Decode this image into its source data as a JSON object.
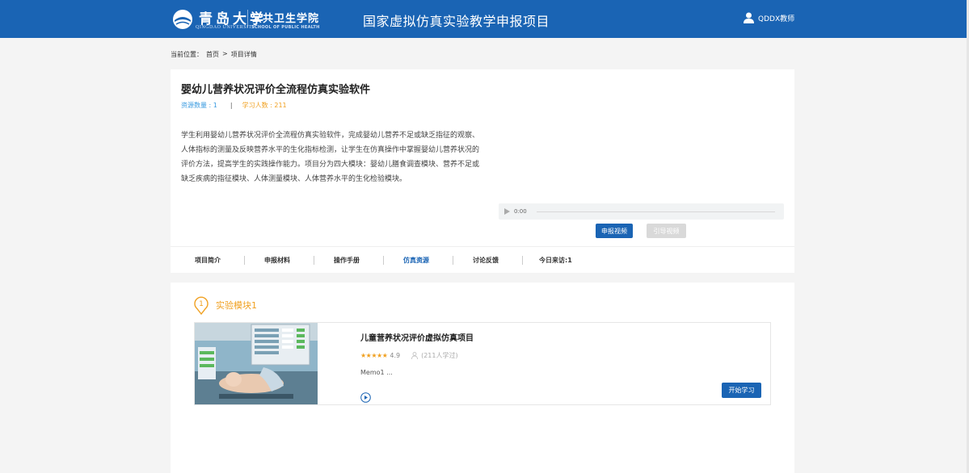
{
  "header": {
    "logo_cn": "青岛大学",
    "logo_en": "QINGDAO UNIVERSITY",
    "school_name": "公共卫生学院",
    "school_en": "SCHOOL OF PUBLIC HEALTH",
    "site_title": "国家虚拟仿真实验教学申报项目",
    "user_name": "QDDX教师",
    "user_icon": "user-icon",
    "brand_color": "#1a64b4"
  },
  "breadcrumb": {
    "label": "当前位置：",
    "home": "首页",
    "separator": ">",
    "current": "项目详情"
  },
  "project": {
    "title": "婴幼儿营养状况评价全流程仿真实验软件",
    "resource_count": "资源数量 : 1",
    "divider": "|",
    "learner_count": "学习人数 : 211",
    "description": "学生利用婴幼儿营养状况评价全流程仿真实验软件，完成婴幼儿营养不足或缺乏指征的观察、人体指标的测量及反映营养水平的生化指标检测，让学生在仿真操作中掌握婴幼儿营养状况的评价方法，提高学生的实践操作能力。项目分为四大模块：婴幼儿膳食调查模块、营养不足或缺乏疾病的指征模块、人体测量模块、人体营养水平的生化检验模块。",
    "audio_time": "0:00",
    "apply_video_label": "申报视频",
    "guide_video_label": "引导视频"
  },
  "tabs": [
    {
      "label": "项目简介"
    },
    {
      "label": "申报材料"
    },
    {
      "label": "操作手册"
    },
    {
      "label": "仿真资源",
      "active": true
    },
    {
      "label": "讨论反馈"
    },
    {
      "label": "今日来访:1"
    }
  ],
  "modules": [
    {
      "number": "1",
      "title": "实验模块1",
      "course": {
        "name": "儿童营养状况评价虚拟仿真项目",
        "stars": "★★★★★",
        "rating": "4.9",
        "learners": "(211人学过)",
        "memo": "Memo1 ...",
        "start_label": "开始学习"
      }
    }
  ]
}
